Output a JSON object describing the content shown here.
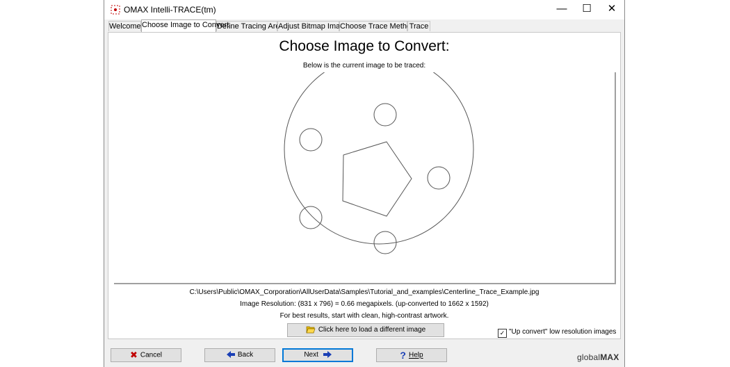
{
  "window": {
    "title": "OMAX Intelli-TRACE(tm)",
    "controls": {
      "minimize": "—",
      "maximize": "☐",
      "close": "✕"
    }
  },
  "tabs": [
    {
      "label": "Welcome"
    },
    {
      "label": "Choose Image to Convert"
    },
    {
      "label": "Define Tracing Area"
    },
    {
      "label": "Adjust Bitmap Image"
    },
    {
      "label": "Choose Trace Method"
    },
    {
      "label": "Trace"
    }
  ],
  "main": {
    "heading": "Choose Image to Convert:",
    "subtext": "Below is the current image to be traced:",
    "file_path": "C:\\Users\\Public\\OMAX_Corporation\\AllUserData\\Samples\\Tutorial_and_examples\\Centerline_Trace_Example.jpg",
    "resolution": "Image Resolution: (831 x 796) = 0.66 megapixels.  (up-converted to 1662 x 1592)",
    "tip": "For best results, start with clean, high-contrast artwork.",
    "load_button": "Click here to load a different image",
    "upconvert_label": "\"Up convert\" low resolution images",
    "upconvert_checked": true
  },
  "buttons": {
    "cancel": "Cancel",
    "back": "Back",
    "next": "Next",
    "help": "Help"
  },
  "brand": {
    "prefix": "global",
    "suffix": "MAX"
  },
  "colors": {
    "accent": "#0078d7",
    "cancel_icon": "#c00000",
    "arrow_icon": "#1a3fb5"
  }
}
